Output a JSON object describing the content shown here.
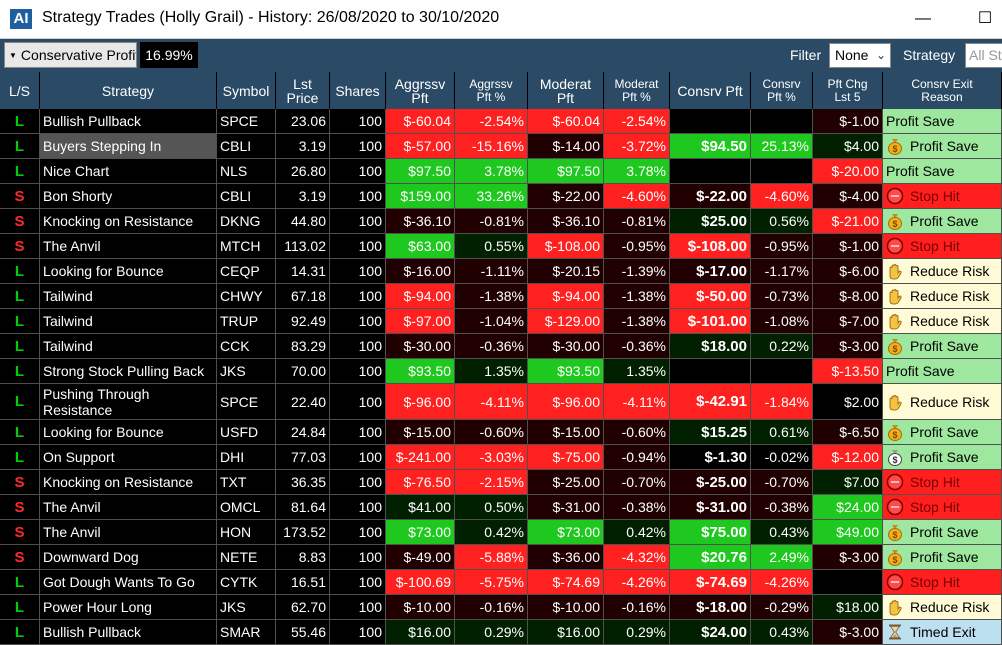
{
  "window": {
    "title": "Strategy Trades (Holly Grail) - History: 26/08/2020 to 30/10/2020",
    "app_icon": "AI",
    "minimize": "—",
    "maximize": "☐"
  },
  "toolbar": {
    "profit_filter": "Conservative Profit",
    "profit_value": "16.99%",
    "filter_label": "Filter",
    "filter_value": "None",
    "strategy_label": "Strategy",
    "strategy_value": "All Str"
  },
  "columns": [
    {
      "key": "ls",
      "label": "L/S"
    },
    {
      "key": "strategy",
      "label": "Strategy"
    },
    {
      "key": "symbol",
      "label": "Symbol"
    },
    {
      "key": "price",
      "label": "Lst\nPrice"
    },
    {
      "key": "shares",
      "label": "Shares"
    },
    {
      "key": "agg_pft",
      "label": "Aggrssv\nPft"
    },
    {
      "key": "agg_pct",
      "label": "Aggrssv\nPft %"
    },
    {
      "key": "mod_pft",
      "label": "Moderat\nPft"
    },
    {
      "key": "mod_pct",
      "label": "Moderat\nPft %"
    },
    {
      "key": "cons_pft",
      "label": "Consrv Pft"
    },
    {
      "key": "cons_pct",
      "label": "Consrv\nPft %"
    },
    {
      "key": "pft_chg",
      "label": "Pft Chg\nLst 5"
    },
    {
      "key": "reason",
      "label": "Consrv Exit\nReason"
    }
  ],
  "colors": {
    "header_bg": "#2a4a66",
    "long": "#00d000",
    "short": "#ff2a2a",
    "profit_save_bg": "#9ee79e",
    "stop_hit_bg": "#ff1f1f",
    "reduce_risk_bg": "#fffbd6",
    "timed_exit_bg": "#bde0f0"
  },
  "rows": [
    {
      "ls": "L",
      "strategy": "Bullish Pullback",
      "symbol": "SPCE",
      "price": "23.06",
      "shares": "100",
      "agg_pft": "$-60.04",
      "agg_pct": "-2.54%",
      "mod_pft": "$-60.04",
      "mod_pct": "-2.54%",
      "cons_pft": "",
      "cons_pct": "",
      "pft_chg": "$-1.00",
      "reason": "Profit Save",
      "icon": "none",
      "c": {
        "agg_pft": "#ff2020",
        "agg_pct": "#ff2020",
        "mod_pft": "#ff2020",
        "mod_pct": "#ff2020",
        "cons_pft": "#000000",
        "cons_pct": "#000000",
        "pft_chg": "#200000"
      }
    },
    {
      "ls": "L",
      "strategy": "Buyers Stepping In",
      "symbol": "CBLI",
      "price": "3.19",
      "shares": "100",
      "agg_pft": "$-57.00",
      "agg_pct": "-15.16%",
      "mod_pft": "$-14.00",
      "mod_pct": "-3.72%",
      "cons_pft": "$94.50",
      "cons_pct": "25.13%",
      "pft_chg": "$4.00",
      "reason": "Profit Save",
      "icon": "moneybag",
      "selected": true,
      "c": {
        "agg_pft": "#ff2020",
        "agg_pct": "#ff2020",
        "mod_pft": "#200000",
        "mod_pct": "#ff2020",
        "cons_pft": "#1fc81f",
        "cons_pct": "#1fc81f",
        "pft_chg": "#002000"
      }
    },
    {
      "ls": "L",
      "strategy": "Nice Chart",
      "symbol": "NLS",
      "price": "26.80",
      "shares": "100",
      "agg_pft": "$97.50",
      "agg_pct": "3.78%",
      "mod_pft": "$97.50",
      "mod_pct": "3.78%",
      "cons_pft": "",
      "cons_pct": "",
      "pft_chg": "$-20.00",
      "reason": "Profit Save",
      "icon": "none",
      "c": {
        "agg_pft": "#1fc81f",
        "agg_pct": "#1fc81f",
        "mod_pft": "#1fc81f",
        "mod_pct": "#1fc81f",
        "cons_pft": "#000000",
        "cons_pct": "#000000",
        "pft_chg": "#ff2020"
      }
    },
    {
      "ls": "S",
      "strategy": "Bon Shorty",
      "symbol": "CBLI",
      "price": "3.19",
      "shares": "100",
      "agg_pft": "$159.00",
      "agg_pct": "33.26%",
      "mod_pft": "$-22.00",
      "mod_pct": "-4.60%",
      "cons_pft": "$-22.00",
      "cons_pct": "-4.60%",
      "pft_chg": "$-4.00",
      "reason": "Stop Hit",
      "icon": "stop",
      "c": {
        "agg_pft": "#1fc81f",
        "agg_pct": "#1fc81f",
        "mod_pft": "#200000",
        "mod_pct": "#ff2020",
        "cons_pft": "#200000",
        "cons_pct": "#ff2020",
        "pft_chg": "#200000"
      }
    },
    {
      "ls": "S",
      "strategy": "Knocking on Resistance",
      "symbol": "DKNG",
      "price": "44.80",
      "shares": "100",
      "agg_pft": "$-36.10",
      "agg_pct": "-0.81%",
      "mod_pft": "$-36.10",
      "mod_pct": "-0.81%",
      "cons_pft": "$25.00",
      "cons_pct": "0.56%",
      "pft_chg": "$-21.00",
      "reason": "Profit Save",
      "icon": "moneybag",
      "c": {
        "agg_pft": "#200000",
        "agg_pct": "#200000",
        "mod_pft": "#200000",
        "mod_pct": "#200000",
        "cons_pft": "#002000",
        "cons_pct": "#002000",
        "pft_chg": "#ff2020"
      }
    },
    {
      "ls": "S",
      "strategy": "The Anvil",
      "symbol": "MTCH",
      "price": "113.02",
      "shares": "100",
      "agg_pft": "$63.00",
      "agg_pct": "0.55%",
      "mod_pft": "$-108.00",
      "mod_pct": "-0.95%",
      "cons_pft": "$-108.00",
      "cons_pct": "-0.95%",
      "pft_chg": "$-1.00",
      "reason": "Stop Hit",
      "icon": "stop",
      "c": {
        "agg_pft": "#1fc81f",
        "agg_pct": "#002000",
        "mod_pft": "#ff2020",
        "mod_pct": "#200000",
        "cons_pft": "#ff2020",
        "cons_pct": "#200000",
        "pft_chg": "#200000"
      }
    },
    {
      "ls": "L",
      "strategy": "Looking for Bounce",
      "symbol": "CEQP",
      "price": "14.31",
      "shares": "100",
      "agg_pft": "$-16.00",
      "agg_pct": "-1.11%",
      "mod_pft": "$-20.15",
      "mod_pct": "-1.39%",
      "cons_pft": "$-17.00",
      "cons_pct": "-1.17%",
      "pft_chg": "$-6.00",
      "reason": "Reduce Risk",
      "icon": "hand",
      "c": {
        "agg_pft": "#200000",
        "agg_pct": "#200000",
        "mod_pft": "#200000",
        "mod_pct": "#200000",
        "cons_pft": "#200000",
        "cons_pct": "#200000",
        "pft_chg": "#200000"
      }
    },
    {
      "ls": "L",
      "strategy": "Tailwind",
      "symbol": "CHWY",
      "price": "67.18",
      "shares": "100",
      "agg_pft": "$-94.00",
      "agg_pct": "-1.38%",
      "mod_pft": "$-94.00",
      "mod_pct": "-1.38%",
      "cons_pft": "$-50.00",
      "cons_pct": "-0.73%",
      "pft_chg": "$-8.00",
      "reason": "Reduce Risk",
      "icon": "hand",
      "c": {
        "agg_pft": "#ff2020",
        "agg_pct": "#200000",
        "mod_pft": "#ff2020",
        "mod_pct": "#200000",
        "cons_pft": "#ff2020",
        "cons_pct": "#200000",
        "pft_chg": "#200000"
      }
    },
    {
      "ls": "L",
      "strategy": "Tailwind",
      "symbol": "TRUP",
      "price": "92.49",
      "shares": "100",
      "agg_pft": "$-97.00",
      "agg_pct": "-1.04%",
      "mod_pft": "$-129.00",
      "mod_pct": "-1.38%",
      "cons_pft": "$-101.00",
      "cons_pct": "-1.08%",
      "pft_chg": "$-7.00",
      "reason": "Reduce Risk",
      "icon": "hand",
      "c": {
        "agg_pft": "#ff2020",
        "agg_pct": "#200000",
        "mod_pft": "#ff2020",
        "mod_pct": "#200000",
        "cons_pft": "#ff2020",
        "cons_pct": "#200000",
        "pft_chg": "#200000"
      }
    },
    {
      "ls": "L",
      "strategy": "Tailwind",
      "symbol": "CCK",
      "price": "83.29",
      "shares": "100",
      "agg_pft": "$-30.00",
      "agg_pct": "-0.36%",
      "mod_pft": "$-30.00",
      "mod_pct": "-0.36%",
      "cons_pft": "$18.00",
      "cons_pct": "0.22%",
      "pft_chg": "$-3.00",
      "reason": "Profit Save",
      "icon": "moneybag",
      "c": {
        "agg_pft": "#200000",
        "agg_pct": "#200000",
        "mod_pft": "#200000",
        "mod_pct": "#200000",
        "cons_pft": "#002000",
        "cons_pct": "#002000",
        "pft_chg": "#200000"
      }
    },
    {
      "ls": "L",
      "strategy": "Strong Stock Pulling Back",
      "symbol": "JKS",
      "price": "70.00",
      "shares": "100",
      "agg_pft": "$93.50",
      "agg_pct": "1.35%",
      "mod_pft": "$93.50",
      "mod_pct": "1.35%",
      "cons_pft": "",
      "cons_pct": "",
      "pft_chg": "$-13.50",
      "reason": "Profit Save",
      "icon": "none",
      "c": {
        "agg_pft": "#1fc81f",
        "agg_pct": "#002000",
        "mod_pft": "#1fc81f",
        "mod_pct": "#002000",
        "cons_pft": "#000000",
        "cons_pct": "#000000",
        "pft_chg": "#ff2020"
      }
    },
    {
      "ls": "L",
      "strategy": "Pushing Through Resistance",
      "symbol": "SPCE",
      "price": "22.40",
      "shares": "100",
      "agg_pft": "$-96.00",
      "agg_pct": "-4.11%",
      "mod_pft": "$-96.00",
      "mod_pct": "-4.11%",
      "cons_pft": "$-42.91",
      "cons_pct": "-1.84%",
      "pft_chg": "$2.00",
      "reason": "Reduce Risk",
      "icon": "hand",
      "tall": true,
      "c": {
        "agg_pft": "#ff2020",
        "agg_pct": "#ff2020",
        "mod_pft": "#ff2020",
        "mod_pct": "#ff2020",
        "cons_pft": "#ff2020",
        "cons_pct": "#ff2020",
        "pft_chg": "#000000"
      }
    },
    {
      "ls": "L",
      "strategy": "Looking for Bounce",
      "symbol": "USFD",
      "price": "24.84",
      "shares": "100",
      "agg_pft": "$-15.00",
      "agg_pct": "-0.60%",
      "mod_pft": "$-15.00",
      "mod_pct": "-0.60%",
      "cons_pft": "$15.25",
      "cons_pct": "0.61%",
      "pft_chg": "$-6.50",
      "reason": "Profit Save",
      "icon": "moneybag",
      "c": {
        "agg_pft": "#200000",
        "agg_pct": "#200000",
        "mod_pft": "#200000",
        "mod_pct": "#200000",
        "cons_pft": "#002000",
        "cons_pct": "#002000",
        "pft_chg": "#200000"
      }
    },
    {
      "ls": "L",
      "strategy": "On Support",
      "symbol": "DHI",
      "price": "77.03",
      "shares": "100",
      "agg_pft": "$-241.00",
      "agg_pct": "-3.03%",
      "mod_pft": "$-75.00",
      "mod_pct": "-0.94%",
      "cons_pft": "$-1.30",
      "cons_pct": "-0.02%",
      "pft_chg": "$-12.00",
      "reason": "Profit Save",
      "icon": "moneybag-white",
      "c": {
        "agg_pft": "#ff2020",
        "agg_pct": "#ff2020",
        "mod_pft": "#ff2020",
        "mod_pct": "#200000",
        "cons_pft": "#000000",
        "cons_pct": "#000000",
        "pft_chg": "#ff2020"
      }
    },
    {
      "ls": "S",
      "strategy": "Knocking on Resistance",
      "symbol": "TXT",
      "price": "36.35",
      "shares": "100",
      "agg_pft": "$-76.50",
      "agg_pct": "-2.15%",
      "mod_pft": "$-25.00",
      "mod_pct": "-0.70%",
      "cons_pft": "$-25.00",
      "cons_pct": "-0.70%",
      "pft_chg": "$7.00",
      "reason": "Stop Hit",
      "icon": "stop",
      "c": {
        "agg_pft": "#ff2020",
        "agg_pct": "#ff2020",
        "mod_pft": "#200000",
        "mod_pct": "#200000",
        "cons_pft": "#200000",
        "cons_pct": "#200000",
        "pft_chg": "#002000"
      }
    },
    {
      "ls": "S",
      "strategy": "The Anvil",
      "symbol": "OMCL",
      "price": "81.64",
      "shares": "100",
      "agg_pft": "$41.00",
      "agg_pct": "0.50%",
      "mod_pft": "$-31.00",
      "mod_pct": "-0.38%",
      "cons_pft": "$-31.00",
      "cons_pct": "-0.38%",
      "pft_chg": "$24.00",
      "reason": "Stop Hit",
      "icon": "stop",
      "c": {
        "agg_pft": "#002000",
        "agg_pct": "#002000",
        "mod_pft": "#200000",
        "mod_pct": "#200000",
        "cons_pft": "#200000",
        "cons_pct": "#200000",
        "pft_chg": "#1fc81f"
      }
    },
    {
      "ls": "S",
      "strategy": "The Anvil",
      "symbol": "HON",
      "price": "173.52",
      "shares": "100",
      "agg_pft": "$73.00",
      "agg_pct": "0.42%",
      "mod_pft": "$73.00",
      "mod_pct": "0.42%",
      "cons_pft": "$75.00",
      "cons_pct": "0.43%",
      "pft_chg": "$49.00",
      "reason": "Profit Save",
      "icon": "moneybag",
      "c": {
        "agg_pft": "#1fc81f",
        "agg_pct": "#002000",
        "mod_pft": "#1fc81f",
        "mod_pct": "#002000",
        "cons_pft": "#1fc81f",
        "cons_pct": "#002000",
        "pft_chg": "#1fc81f"
      }
    },
    {
      "ls": "S",
      "strategy": "Downward Dog",
      "symbol": "NETE",
      "price": "8.83",
      "shares": "100",
      "agg_pft": "$-49.00",
      "agg_pct": "-5.88%",
      "mod_pft": "$-36.00",
      "mod_pct": "-4.32%",
      "cons_pft": "$20.76",
      "cons_pct": "2.49%",
      "pft_chg": "$-3.00",
      "reason": "Profit Save",
      "icon": "moneybag",
      "c": {
        "agg_pft": "#200000",
        "agg_pct": "#ff2020",
        "mod_pft": "#200000",
        "mod_pct": "#ff2020",
        "cons_pft": "#1fc81f",
        "cons_pct": "#1fc81f",
        "pft_chg": "#200000"
      }
    },
    {
      "ls": "L",
      "strategy": "Got Dough Wants To Go",
      "symbol": "CYTK",
      "price": "16.51",
      "shares": "100",
      "agg_pft": "$-100.69",
      "agg_pct": "-5.75%",
      "mod_pft": "$-74.69",
      "mod_pct": "-4.26%",
      "cons_pft": "$-74.69",
      "cons_pct": "-4.26%",
      "pft_chg": "",
      "reason": "Stop Hit",
      "icon": "stop",
      "c": {
        "agg_pft": "#ff2020",
        "agg_pct": "#ff2020",
        "mod_pft": "#ff2020",
        "mod_pct": "#ff2020",
        "cons_pft": "#ff2020",
        "cons_pct": "#ff2020",
        "pft_chg": "#000000"
      }
    },
    {
      "ls": "L",
      "strategy": "Power Hour Long",
      "symbol": "JKS",
      "price": "62.70",
      "shares": "100",
      "agg_pft": "$-10.00",
      "agg_pct": "-0.16%",
      "mod_pft": "$-10.00",
      "mod_pct": "-0.16%",
      "cons_pft": "$-18.00",
      "cons_pct": "-0.29%",
      "pft_chg": "$18.00",
      "reason": "Reduce Risk",
      "icon": "hand",
      "c": {
        "agg_pft": "#200000",
        "agg_pct": "#200000",
        "mod_pft": "#200000",
        "mod_pct": "#200000",
        "cons_pft": "#200000",
        "cons_pct": "#200000",
        "pft_chg": "#002000"
      }
    },
    {
      "ls": "L",
      "strategy": "Bullish Pullback",
      "symbol": "SMAR",
      "price": "55.46",
      "shares": "100",
      "agg_pft": "$16.00",
      "agg_pct": "0.29%",
      "mod_pft": "$16.00",
      "mod_pct": "0.29%",
      "cons_pft": "$24.00",
      "cons_pct": "0.43%",
      "pft_chg": "$-3.00",
      "reason": "Timed Exit",
      "icon": "hourglass",
      "c": {
        "agg_pft": "#002000",
        "agg_pct": "#002000",
        "mod_pft": "#002000",
        "mod_pct": "#002000",
        "cons_pft": "#002000",
        "cons_pct": "#002000",
        "pft_chg": "#200000"
      }
    }
  ]
}
